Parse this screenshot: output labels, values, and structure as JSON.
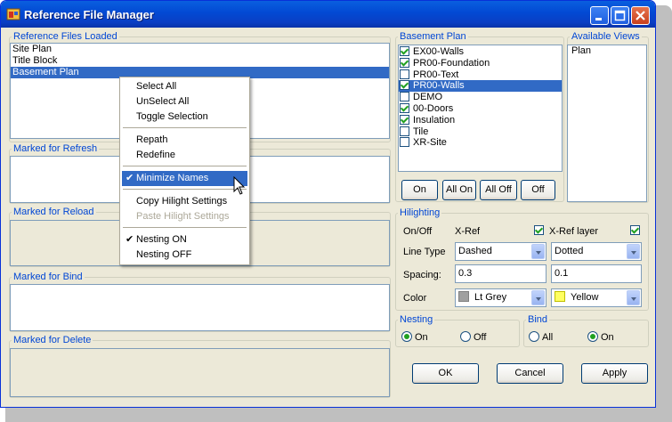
{
  "window": {
    "title": "Reference File Manager"
  },
  "reference_files": {
    "legend": "Reference Files Loaded",
    "items": [
      "Site Plan",
      "Title Block",
      "Basement Plan"
    ],
    "selected_index": 2
  },
  "groups": {
    "refresh": "Marked for Refresh",
    "reload": "Marked for Reload",
    "bind": "Marked for Bind",
    "delete": "Marked for Delete"
  },
  "layers": {
    "legend": "Basement Plan",
    "items": [
      {
        "label": "EX00-Walls",
        "checked": true
      },
      {
        "label": "PR00-Foundation",
        "checked": true
      },
      {
        "label": "PR00-Text",
        "checked": false
      },
      {
        "label": "PR00-Walls",
        "checked": true,
        "selected": true
      },
      {
        "label": "DEMO",
        "checked": false
      },
      {
        "label": "00-Doors",
        "checked": true
      },
      {
        "label": "Insulation",
        "checked": true
      },
      {
        "label": "Tile",
        "checked": false
      },
      {
        "label": "XR-Site",
        "checked": false
      }
    ],
    "buttons": {
      "on": "On",
      "all_on": "All On",
      "all_off": "All Off",
      "off": "Off"
    }
  },
  "views": {
    "legend": "Available Views",
    "items": [
      "Plan"
    ]
  },
  "hilighting": {
    "legend": "Hilighting",
    "onoff_label": "On/Off",
    "xref_label": "X-Ref",
    "xref_checked": true,
    "xref_layer_label": "X-Ref layer",
    "xref_layer_checked": true,
    "linetype_label": "Line Type",
    "linetype_xref": "Dashed",
    "linetype_layer": "Dotted",
    "spacing_label": "Spacing:",
    "spacing_xref": "0.3",
    "spacing_layer": "0.1",
    "color_label": "Color",
    "color_xref": "Lt Grey",
    "color_xref_hex": "#a0a0a0",
    "color_layer": "Yellow",
    "color_layer_hex": "#ffff60"
  },
  "nesting": {
    "legend": "Nesting",
    "on": "On",
    "off": "Off",
    "value": "On"
  },
  "bind": {
    "legend": "Bind",
    "all": "All",
    "on": "On",
    "value": "On"
  },
  "footer": {
    "ok": "OK",
    "cancel": "Cancel",
    "apply": "Apply"
  },
  "context_menu": {
    "select_all": "Select All",
    "unselect_all": "UnSelect All",
    "toggle_selection": "Toggle Selection",
    "repath": "Repath",
    "redefine": "Redefine",
    "minimize_names": "Minimize Names",
    "copy_hilight": "Copy Hilight Settings",
    "paste_hilight": "Paste Hilight Settings",
    "nesting_on": "Nesting ON",
    "nesting_off": "Nesting OFF",
    "check_glyph": "✔"
  }
}
